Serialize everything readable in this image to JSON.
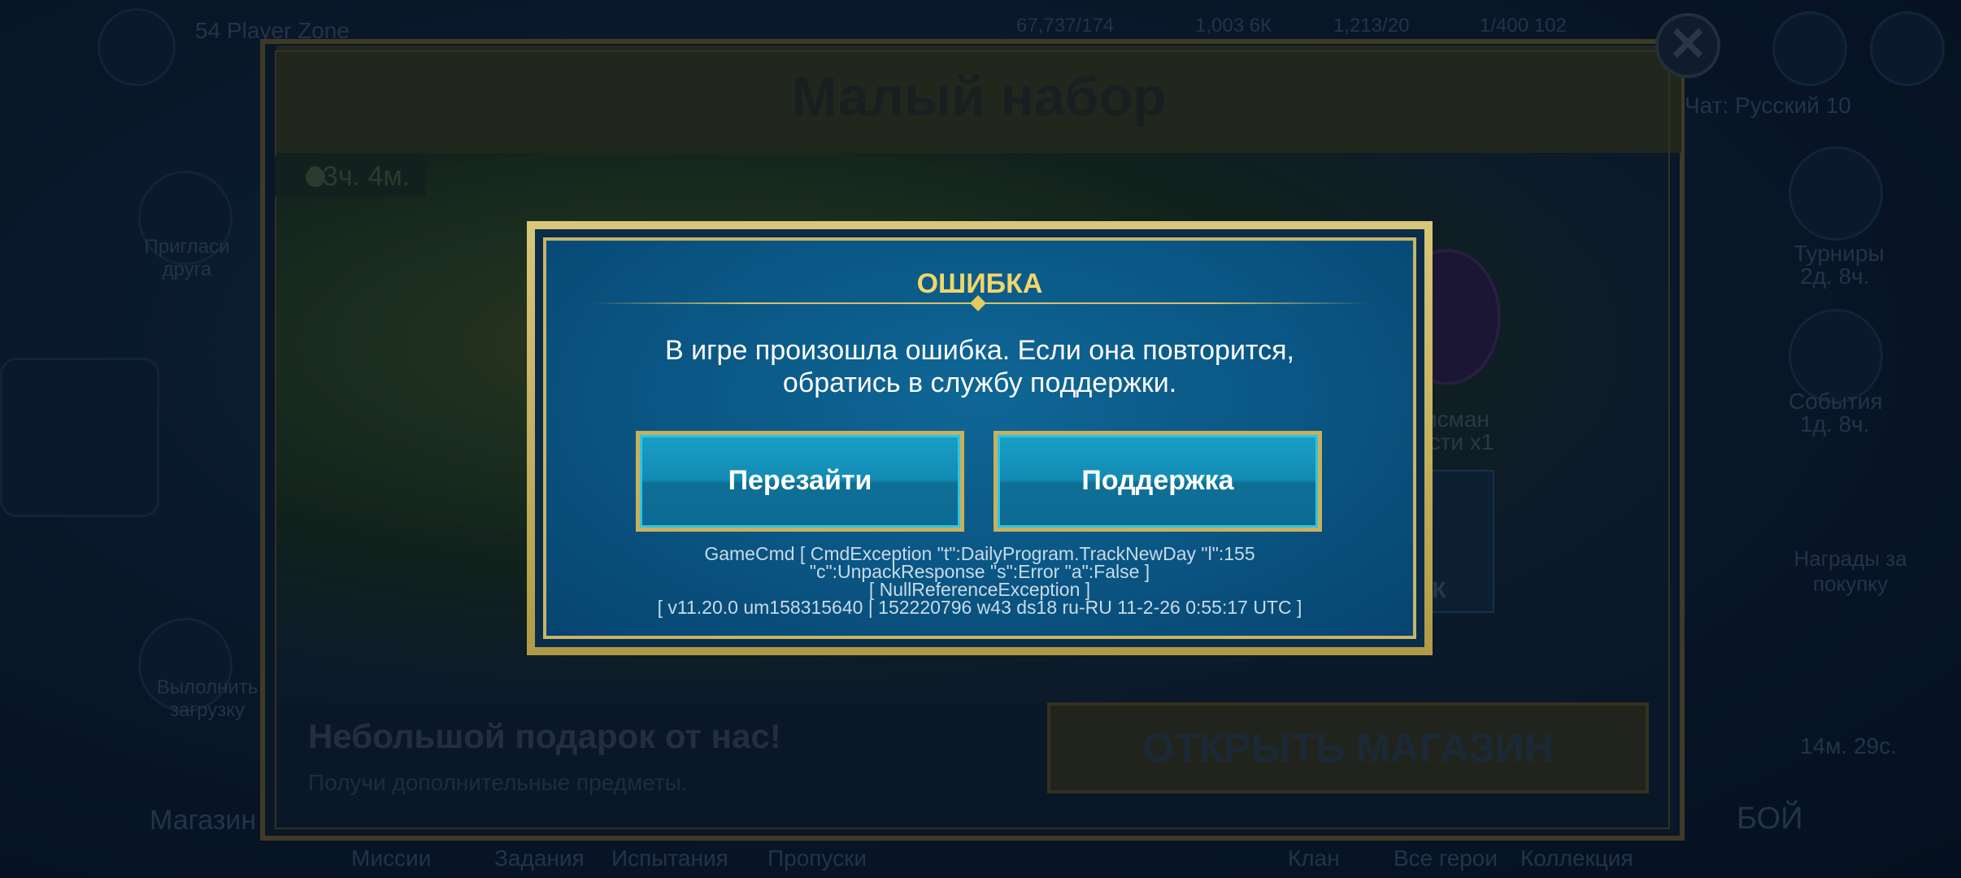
{
  "background": {
    "top_left_text": "54 Player Zone",
    "resources": [
      "67,737/174",
      "1,003 6К",
      "1,213/20",
      "1/400 102"
    ],
    "left_side": {
      "invite": "Пригласи друга",
      "daily": "Вылолнить загрузку"
    },
    "right_side": {
      "chat": "Чат: Русский 10",
      "tournaments_label": "Турниры",
      "tournaments_time": "2д. 8ч.",
      "events_label": "События",
      "events_time": "1д. 8ч.",
      "rewards_label": "Награды за покупку",
      "right_timer": "14м. 29с.",
      "battle": "БОЙ"
    },
    "bottom_nav": [
      "Миссии",
      "Задания",
      "Испытания",
      "Пропуски",
      "Клан",
      "Все герои",
      "Коллекция"
    ],
    "shop_tab": "Магазин"
  },
  "store_panel": {
    "title": "Малый набор",
    "timer": "23ч. 4м.",
    "gift_title": "Небольшой подарок от нас!",
    "gift_subtitle": "Получи дополнительные предметы.",
    "open_store_button": "ОТКРЫТЬ МАГАЗИН",
    "offer_label_1": "исман",
    "offer_label_2": "ости x1",
    "offer_amount": "5К",
    "close_icon": "close-icon"
  },
  "error_dialog": {
    "title": "ОШИБКА",
    "message_line1": "В игре произошла ошибка. Если она повторится,",
    "message_line2": "обратись в службу поддержки.",
    "buttons": {
      "relog": "Перезайти",
      "support": "Поддержка"
    },
    "debug_lines": [
      "GameCmd [ CmdException \"t\":DailyProgram.TrackNewDay \"l\":155",
      "\"c\":UnpackResponse \"s\":Error \"a\":False ]",
      "[ NullReferenceException ]",
      "[ v11.20.0  um158315640 | 152220796  w43  ds18  ru-RU  11-2-26 0:55:17 UTC ]"
    ]
  },
  "colors": {
    "dialog_title": "#f1d66a",
    "dialog_bg": "#0a5583",
    "frame_gold": "#c9b466",
    "button_bg": "#138bb4"
  }
}
